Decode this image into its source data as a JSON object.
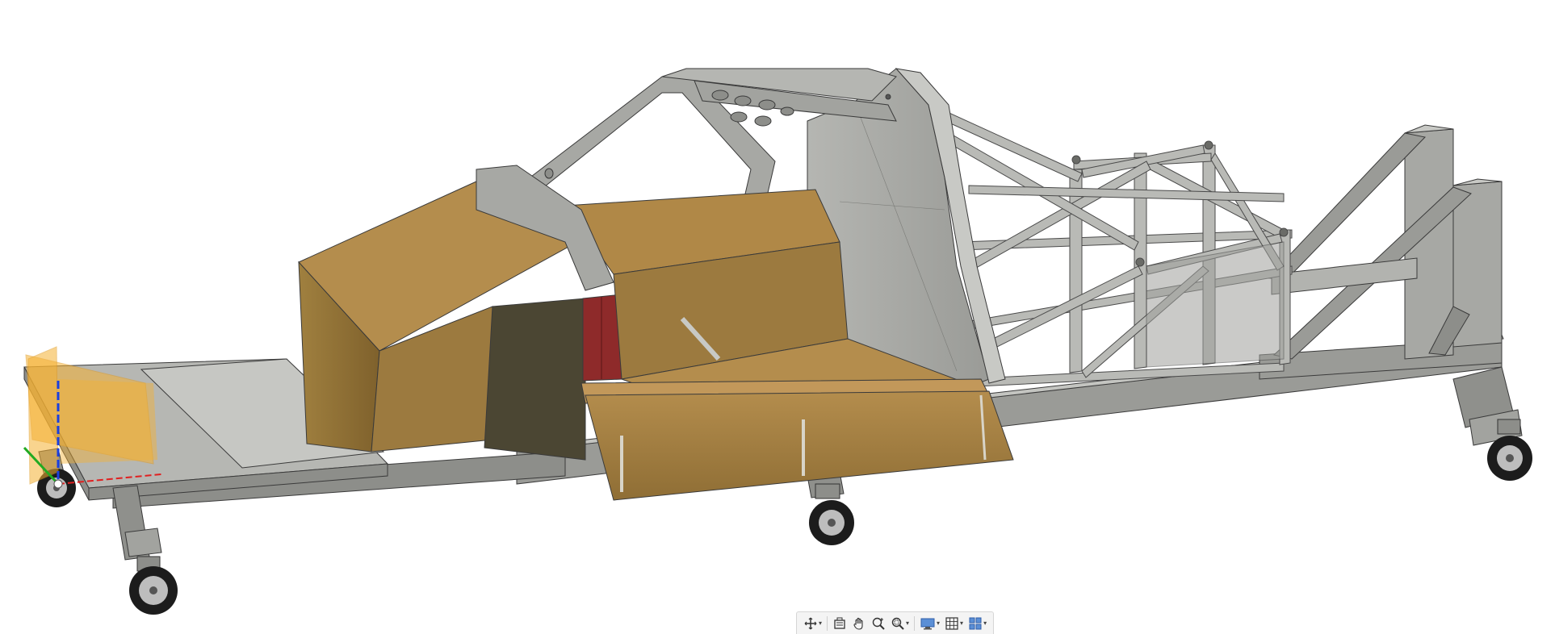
{
  "app": {
    "name": "3D CAD viewport",
    "canvas_background": "#ffffff"
  },
  "model": {
    "colors": {
      "frame": "#a7a8a4",
      "frame_dark": "#7b7c78",
      "frame_light": "#c8c9c5",
      "panel_tan": "#9c7a3f",
      "panel_tan_light": "#b48d4d",
      "panel_olive": "#4b4633",
      "panel_red": "#8e2a2a",
      "origin_plane": "#f5b133",
      "axis_x": "#e02020",
      "axis_y": "#22aa22",
      "axis_z": "#1a3fe0"
    }
  },
  "toolbar": {
    "items": [
      {
        "icon": "orbit-icon",
        "has_menu": true
      },
      {
        "icon": "look-at-icon",
        "has_menu": false
      },
      {
        "icon": "pan-hand-icon",
        "has_menu": false
      },
      {
        "icon": "zoom-icon",
        "has_menu": false
      },
      {
        "icon": "fit-zoom-icon",
        "has_menu": true
      },
      {
        "icon": "display-settings-icon",
        "has_menu": true
      },
      {
        "icon": "grid-snaps-icon",
        "has_menu": true
      },
      {
        "icon": "viewports-icon",
        "has_menu": true
      }
    ],
    "caret": "▾"
  }
}
